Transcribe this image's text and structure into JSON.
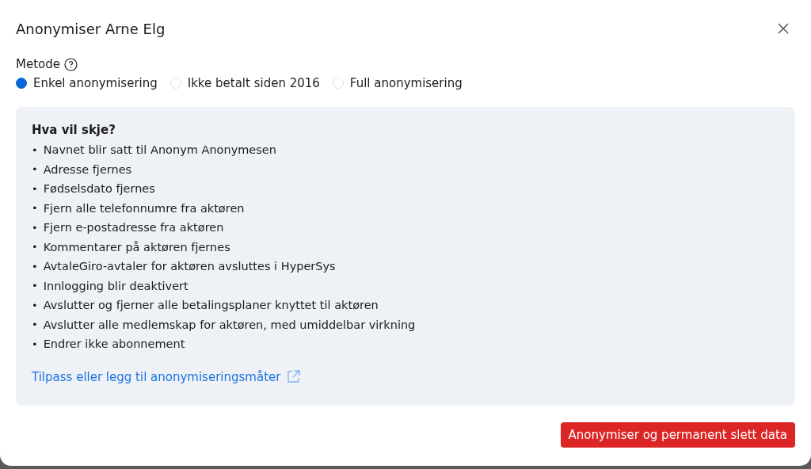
{
  "dialog": {
    "title": "Anonymiser Arne Elg"
  },
  "method": {
    "label": "Metode",
    "options": [
      {
        "label": "Enkel anonymisering",
        "selected": true
      },
      {
        "label": "Ikke betalt siden 2016",
        "selected": false
      },
      {
        "label": "Full anonymisering",
        "selected": false
      }
    ]
  },
  "info": {
    "heading": "Hva vil skje?",
    "bullet": "•",
    "items": [
      "Navnet blir satt til Anonym Anonymesen",
      "Adresse fjernes",
      "Fødselsdato fjernes",
      "Fjern alle telefonnumre fra aktøren",
      "Fjern e-postadresse fra aktøren",
      "Kommentarer på aktøren fjernes",
      "AvtaleGiro-avtaler for aktøren avsluttes i HyperSys",
      "Innlogging blir deaktivert",
      "Avslutter og fjerner alle betalingsplaner knyttet til aktøren",
      "Avslutter alle medlemskap for aktøren, med umiddelbar virkning",
      "Endrer ikke abonnement"
    ],
    "link": "Tilpass eller legg til anonymiseringsmåter"
  },
  "confirm_button": "Anonymiser og permanent slett data"
}
